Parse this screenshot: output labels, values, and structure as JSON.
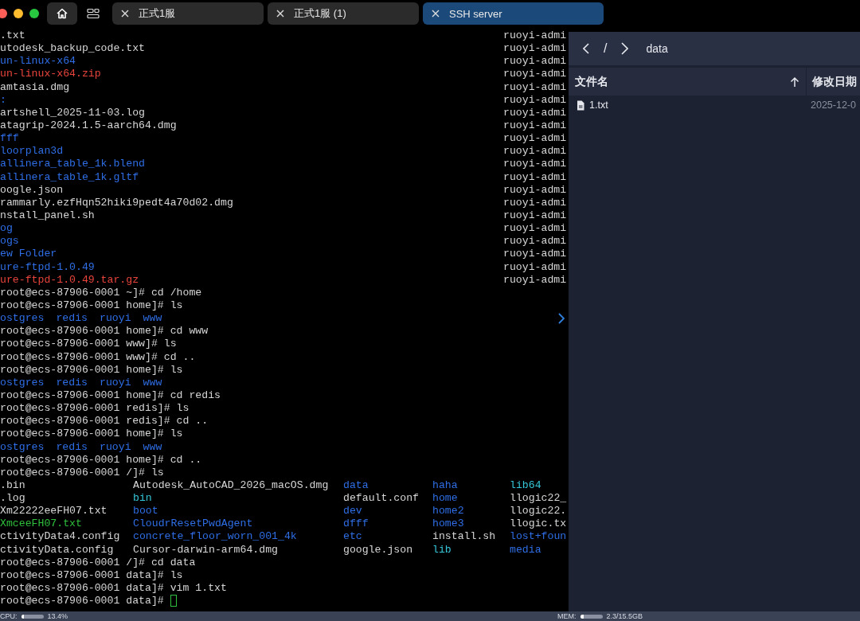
{
  "tabs": [
    {
      "label": "正式1服",
      "selected": false
    },
    {
      "label": "正式1服 (1)",
      "selected": false
    },
    {
      "label": "SSH server",
      "selected": true
    }
  ],
  "terminal": {
    "cursor_visible": true,
    "lines": [
      {
        "kind": "listing",
        "cells": [
          {
            "text": ".txt",
            "kind": "file"
          },
          {
            "text": "ruoyi-admi",
            "kind": "file"
          }
        ]
      },
      {
        "kind": "listing",
        "cells": [
          {
            "text": "utodesk_backup_code.txt",
            "kind": "file"
          },
          {
            "text": "ruoyi-admi",
            "kind": "file"
          }
        ]
      },
      {
        "kind": "listing",
        "cells": [
          {
            "text": "un-linux-x64",
            "kind": "dir"
          },
          {
            "text": "ruoyi-admi",
            "kind": "file"
          }
        ]
      },
      {
        "kind": "listing",
        "cells": [
          {
            "text": "un-linux-x64.zip",
            "kind": "archive"
          },
          {
            "text": "ruoyi-admi",
            "kind": "file"
          }
        ]
      },
      {
        "kind": "listing",
        "cells": [
          {
            "text": "amtasia.dmg",
            "kind": "file"
          },
          {
            "text": "ruoyi-admi",
            "kind": "file"
          }
        ]
      },
      {
        "kind": "listing",
        "cells": [
          {
            "text": ":",
            "kind": "dir"
          },
          {
            "text": "ruoyi-admi",
            "kind": "file"
          }
        ]
      },
      {
        "kind": "listing",
        "cells": [
          {
            "text": "artshell_2025-11-03.log",
            "kind": "file"
          },
          {
            "text": "ruoyi-admi",
            "kind": "file"
          }
        ]
      },
      {
        "kind": "listing",
        "cells": [
          {
            "text": "atagrip-2024.1.5-aarch64.dmg",
            "kind": "file"
          },
          {
            "text": "ruoyi-admi",
            "kind": "file"
          }
        ]
      },
      {
        "kind": "listing",
        "cells": [
          {
            "text": "fff",
            "kind": "dir"
          },
          {
            "text": "ruoyi-admi",
            "kind": "file"
          }
        ]
      },
      {
        "kind": "listing",
        "cells": [
          {
            "text": "loorplan3d",
            "kind": "dir"
          },
          {
            "text": "ruoyi-admi",
            "kind": "file"
          }
        ]
      },
      {
        "kind": "listing",
        "cells": [
          {
            "text": "allinera_table_1k.blend",
            "kind": "dir"
          },
          {
            "text": "ruoyi-admi",
            "kind": "file"
          }
        ]
      },
      {
        "kind": "listing",
        "cells": [
          {
            "text": "allinera_table_1k.gltf",
            "kind": "dir"
          },
          {
            "text": "ruoyi-admi",
            "kind": "file"
          }
        ]
      },
      {
        "kind": "listing",
        "cells": [
          {
            "text": "oogle.json",
            "kind": "file"
          },
          {
            "text": "ruoyi-admi",
            "kind": "file"
          }
        ]
      },
      {
        "kind": "listing",
        "cells": [
          {
            "text": "rammarly.ezfHqn52hiki9pedt4a70d02.dmg",
            "kind": "file"
          },
          {
            "text": "ruoyi-admi",
            "kind": "file"
          }
        ]
      },
      {
        "kind": "listing",
        "cells": [
          {
            "text": "nstall_panel.sh",
            "kind": "file"
          },
          {
            "text": "ruoyi-admi",
            "kind": "file"
          }
        ]
      },
      {
        "kind": "listing",
        "cells": [
          {
            "text": "og",
            "kind": "dir"
          },
          {
            "text": "ruoyi-admi",
            "kind": "file"
          }
        ]
      },
      {
        "kind": "listing",
        "cells": [
          {
            "text": "ogs",
            "kind": "dir"
          },
          {
            "text": "ruoyi-admi",
            "kind": "file"
          }
        ]
      },
      {
        "kind": "listing",
        "cells": [
          {
            "text": "ew Folder",
            "kind": "dir"
          },
          {
            "text": "ruoyi-admi",
            "kind": "file"
          }
        ]
      },
      {
        "kind": "listing",
        "cells": [
          {
            "text": "ure-ftpd-1.0.49",
            "kind": "dir"
          },
          {
            "text": "ruoyi-admi",
            "kind": "file"
          }
        ]
      },
      {
        "kind": "listing",
        "cells": [
          {
            "text": "ure-ftpd-1.0.49.tar.gz",
            "kind": "archive"
          },
          {
            "text": "ruoyi-admi",
            "kind": "file"
          }
        ]
      },
      {
        "kind": "prompt",
        "text": "root@ecs-87906-0001 ~]# cd /home"
      },
      {
        "kind": "prompt",
        "text": "root@ecs-87906-0001 home]# ls"
      },
      {
        "kind": "ls",
        "cells": [
          {
            "text": "ostgres",
            "kind": "dir"
          },
          {
            "text": "redis",
            "kind": "dir"
          },
          {
            "text": "ruoyi",
            "kind": "dir"
          },
          {
            "text": "www",
            "kind": "dir"
          }
        ]
      },
      {
        "kind": "prompt",
        "text": "root@ecs-87906-0001 home]# cd www"
      },
      {
        "kind": "prompt",
        "text": "root@ecs-87906-0001 www]# ls"
      },
      {
        "kind": "prompt",
        "text": "root@ecs-87906-0001 www]# cd .."
      },
      {
        "kind": "prompt",
        "text": "root@ecs-87906-0001 home]# ls"
      },
      {
        "kind": "ls",
        "cells": [
          {
            "text": "ostgres",
            "kind": "dir"
          },
          {
            "text": "redis",
            "kind": "dir"
          },
          {
            "text": "ruoyi",
            "kind": "dir"
          },
          {
            "text": "www",
            "kind": "dir"
          }
        ]
      },
      {
        "kind": "prompt",
        "text": "root@ecs-87906-0001 home]# cd redis"
      },
      {
        "kind": "prompt",
        "text": "root@ecs-87906-0001 redis]# ls"
      },
      {
        "kind": "prompt",
        "text": "root@ecs-87906-0001 redis]# cd .."
      },
      {
        "kind": "prompt",
        "text": "root@ecs-87906-0001 home]# ls"
      },
      {
        "kind": "ls",
        "cells": [
          {
            "text": "ostgres",
            "kind": "dir"
          },
          {
            "text": "redis",
            "kind": "dir"
          },
          {
            "text": "ruoyi",
            "kind": "dir"
          },
          {
            "text": "www",
            "kind": "dir"
          }
        ]
      },
      {
        "kind": "prompt",
        "text": "root@ecs-87906-0001 home]# cd .."
      },
      {
        "kind": "prompt",
        "text": "root@ecs-87906-0001 /]# ls"
      },
      {
        "kind": "ls-wide",
        "cells": [
          {
            "text": ".bin",
            "kind": "file"
          },
          {
            "text": "Autodesk_AutoCAD_2026_macOS.dmg",
            "kind": "file"
          },
          {
            "text": "data",
            "kind": "dir"
          },
          {
            "text": "haha",
            "kind": "dir"
          },
          {
            "text": "lib64",
            "kind": "link"
          }
        ]
      },
      {
        "kind": "ls-wide",
        "cells": [
          {
            "text": ".log",
            "kind": "file"
          },
          {
            "text": "bin",
            "kind": "link"
          },
          {
            "text": "default.conf",
            "kind": "file"
          },
          {
            "text": "home",
            "kind": "dir"
          },
          {
            "text": "llogic22_",
            "kind": "file"
          }
        ]
      },
      {
        "kind": "ls-wide",
        "cells": [
          {
            "text": "Xm22222eeFH07.txt",
            "kind": "file"
          },
          {
            "text": "boot",
            "kind": "dir"
          },
          {
            "text": "dev",
            "kind": "dir"
          },
          {
            "text": "home2",
            "kind": "dir"
          },
          {
            "text": "llogic22.",
            "kind": "file"
          }
        ]
      },
      {
        "kind": "ls-wide",
        "cells": [
          {
            "text": "XmceeFH07.txt",
            "kind": "exec"
          },
          {
            "text": "CloudrResetPwdAgent",
            "kind": "dir"
          },
          {
            "text": "dfff",
            "kind": "dir"
          },
          {
            "text": "home3",
            "kind": "dir"
          },
          {
            "text": "llogic.tx",
            "kind": "file"
          }
        ]
      },
      {
        "kind": "ls-wide",
        "cells": [
          {
            "text": "ctivityData4.config",
            "kind": "file"
          },
          {
            "text": "concrete_floor_worn_001_4k",
            "kind": "dir"
          },
          {
            "text": "etc",
            "kind": "dir"
          },
          {
            "text": "install.sh",
            "kind": "file"
          },
          {
            "text": "lost+foun",
            "kind": "dir"
          }
        ]
      },
      {
        "kind": "ls-wide",
        "cells": [
          {
            "text": "ctivityData.config",
            "kind": "file"
          },
          {
            "text": "Cursor-darwin-arm64.dmg",
            "kind": "file"
          },
          {
            "text": "google.json",
            "kind": "file"
          },
          {
            "text": "lib",
            "kind": "link"
          },
          {
            "text": "media",
            "kind": "dir"
          }
        ]
      },
      {
        "kind": "prompt",
        "text": "root@ecs-87906-0001 /]# cd data"
      },
      {
        "kind": "prompt",
        "text": "root@ecs-87906-0001 data]# ls"
      },
      {
        "kind": "prompt",
        "text": "root@ecs-87906-0001 data]# vim 1.txt"
      },
      {
        "kind": "prompt",
        "text": "root@ecs-87906-0001 data]#"
      }
    ]
  },
  "file_panel": {
    "path_root": "/",
    "path_segment": "data",
    "columns": [
      "文件名",
      "修改日期"
    ],
    "rows": [
      {
        "name": "1.txt",
        "modified": "2025-12-0"
      }
    ]
  },
  "status_bar": {
    "cpu": {
      "label": "CPU:",
      "level": 0.134,
      "reading": "13.4%"
    },
    "mem": {
      "label": "MEM:",
      "level": 0.15,
      "reading": "2.3/15.5GB"
    }
  }
}
